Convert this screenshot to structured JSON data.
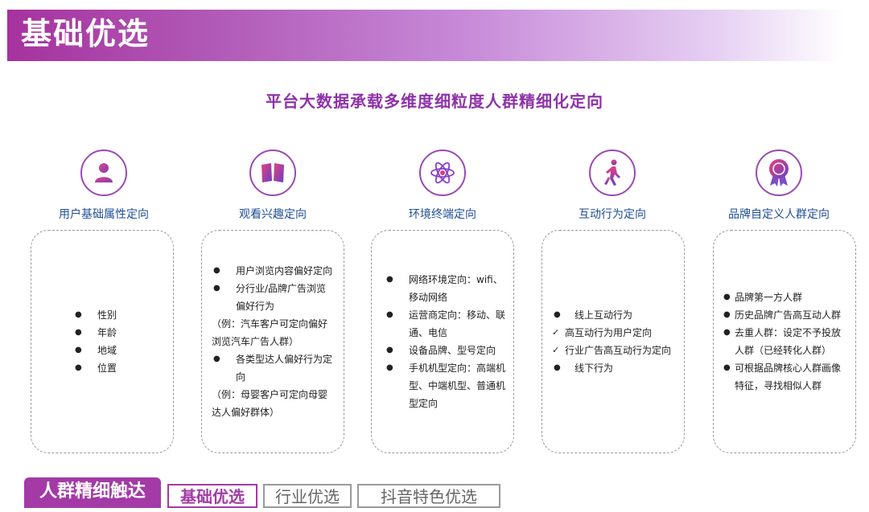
{
  "header": {
    "title": "基础优选"
  },
  "subtitle": "平台大数据承载多维度细粒度人群精细化定向",
  "colors": {
    "accent": "#a33aa6",
    "label_blue": "#1f4e96"
  },
  "columns": [
    {
      "icon": "user-icon",
      "label": "用户基础属性定向",
      "items": [
        "性别",
        "年龄",
        "地域",
        "位置"
      ]
    },
    {
      "icon": "book-icon",
      "label": "观看兴趣定向",
      "items": [
        "用户浏览内容偏好定向",
        "分行业/品牌广告浏览偏好行为",
        "（例：汽车客户可定向偏好浏览汽车广告人群）",
        "各类型达人偏好行为定向",
        "（例：母婴客户可定向母婴达人偏好群体）"
      ]
    },
    {
      "icon": "atom-icon",
      "label": "环境终端定向",
      "items": [
        "网络环境定向：wifi、移动网络",
        "运营商定向：移动、联通、电信",
        "设备品牌、型号定向",
        "手机机型定向：高端机型、中端机型、普通机型定向"
      ]
    },
    {
      "icon": "walking-person-icon",
      "label": "互动行为定向",
      "items": [
        "线上互动行为",
        "高互动行为用户定向",
        "行业广告高互动行为定向",
        "线下行为"
      ]
    },
    {
      "icon": "award-ribbon-icon",
      "label": "品牌自定义人群定向",
      "items": [
        "品牌第一方人群",
        "历史品牌广告高互动人群",
        "去重人群：设定不予投放人群（已经转化人群）",
        "可根据品牌核心人群画像特征，寻找相似人群"
      ]
    }
  ],
  "tabs": {
    "active": "人群精细触达",
    "selected": "基础优选",
    "others": [
      "行业优选",
      "抖音特色优选"
    ]
  }
}
